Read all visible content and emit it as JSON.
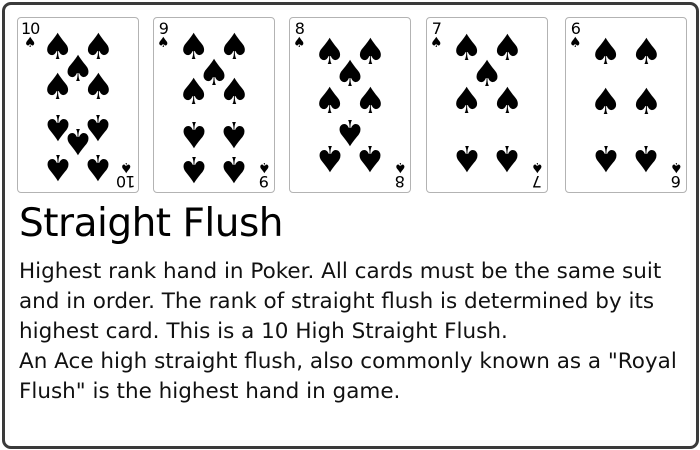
{
  "hand": {
    "title": "Straight Flush",
    "description": [
      "Highest rank hand in Poker. All cards must be the same suit and in order. The rank of straight flush is determined by its highest card. This is a 10 High Straight Flush.",
      "An Ace high straight flush, also commonly known as a \"Royal Flush\" is the highest hand in game."
    ]
  },
  "cards": [
    {
      "rank": "10",
      "suit": "spades",
      "suit_symbol": "♠"
    },
    {
      "rank": "9",
      "suit": "spades",
      "suit_symbol": "♠"
    },
    {
      "rank": "8",
      "suit": "spades",
      "suit_symbol": "♠"
    },
    {
      "rank": "7",
      "suit": "spades",
      "suit_symbol": "♠"
    },
    {
      "rank": "6",
      "suit": "spades",
      "suit_symbol": "♠"
    }
  ],
  "colors": {
    "suit": "#000000",
    "frame": "#3a3a3a"
  }
}
